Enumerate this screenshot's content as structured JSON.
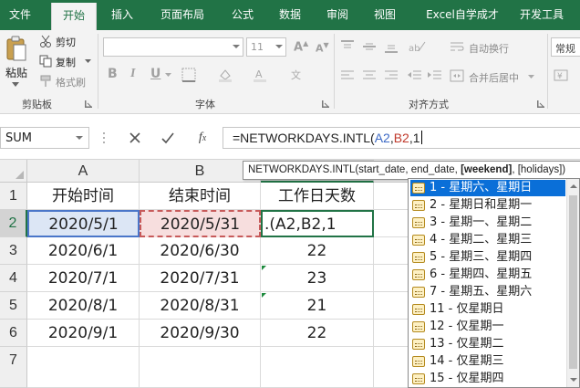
{
  "ribbon_tabs": [
    "文件",
    "开始",
    "插入",
    "页面布局",
    "公式",
    "数据",
    "审阅",
    "视图",
    "Excel自学成才",
    "开发工具"
  ],
  "active_tab": "开始",
  "clipboard": {
    "paste": "粘贴",
    "cut": "剪切",
    "copy": "复制",
    "format_painter": "格式刷",
    "group": "剪贴板"
  },
  "font": {
    "size": "11",
    "group": "字体",
    "bold": "B",
    "italic": "I",
    "underline": "U"
  },
  "alignment": {
    "wrap_text": "自动换行",
    "merge_center": "合并后居中",
    "group": "对齐方式"
  },
  "number_format": "常规",
  "name_box": "SUM",
  "formula": {
    "prefix": "=NETWORKDAYS.INTL(",
    "ref1": "A2",
    "comma1": ",",
    "ref2": "B2",
    "suffix": ",1"
  },
  "tooltip": {
    "prefix": "NETWORKDAYS.INTL(start_date, end_date, ",
    "bold": "[weekend]",
    "suffix": ", [holidays])"
  },
  "columns": [
    "A",
    "B",
    "C"
  ],
  "rows": [
    "1",
    "2",
    "3",
    "4",
    "5",
    "6",
    "7"
  ],
  "table": {
    "headers": [
      "开始时间",
      "结束时间",
      "工作日天数"
    ],
    "rows": [
      [
        "2020/5/1",
        "2020/5/31",
        ".(A2,B2,1"
      ],
      [
        "2020/6/1",
        "2020/6/30",
        "22"
      ],
      [
        "2020/7/1",
        "2020/7/31",
        "23"
      ],
      [
        "2020/8/1",
        "2020/8/31",
        "21"
      ],
      [
        "2020/9/1",
        "2020/9/30",
        "22"
      ]
    ]
  },
  "autocomplete": [
    "1 - 星期六、星期日",
    "2 - 星期日和星期一",
    "3 - 星期一、星期二",
    "4 - 星期二、星期三",
    "5 - 星期三、星期四",
    "6 - 星期四、星期五",
    "7 - 星期五、星期六",
    "11 - 仅星期日",
    "12 - 仅星期一",
    "13 - 仅星期二",
    "14 - 仅星期三",
    "15 - 仅星期四"
  ],
  "autocomplete_selected_index": 0,
  "colors": {
    "ribbon_green": "#217346",
    "ref_blue": "#3c69c5",
    "ref_red": "#c0392b",
    "selection_blue": "#0a6fd8"
  }
}
